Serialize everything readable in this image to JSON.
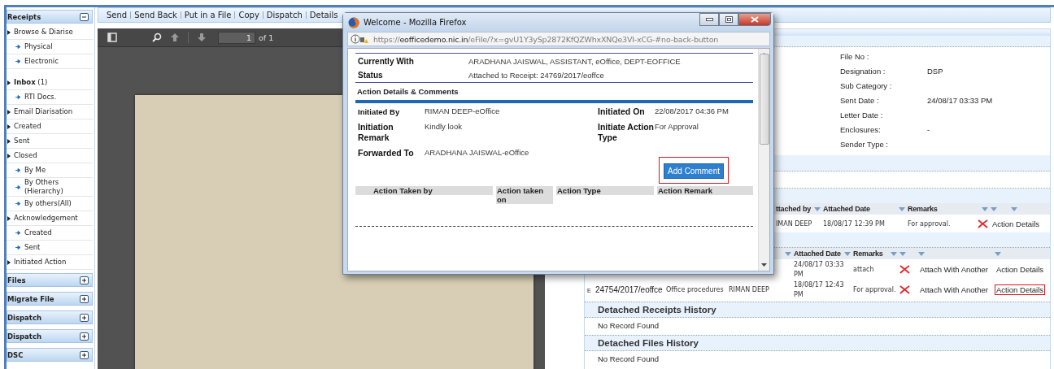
{
  "sidebar": {
    "sections": [
      {
        "title": "Receipts",
        "expanded": true,
        "items": [
          {
            "label": "Browse & Diarise",
            "children": [
              {
                "label": "Physical"
              },
              {
                "label": "Electronic"
              }
            ]
          },
          {
            "label": "**Inbox** (1)",
            "children": [
              {
                "label": "RTI Docs."
              }
            ]
          },
          {
            "label": "Email Diarisation"
          },
          {
            "label": "Created"
          },
          {
            "label": "Sent"
          },
          {
            "label": "Closed",
            "children": [
              {
                "label": "By Me"
              },
              {
                "label": "By Others (Hierarchy)"
              },
              {
                "label": "By others(All)"
              }
            ]
          },
          {
            "label": "Acknowledgement",
            "children": [
              {
                "label": "Created"
              },
              {
                "label": "Sent"
              }
            ]
          },
          {
            "label": "Initiated Action"
          }
        ]
      },
      {
        "title": "Files",
        "expanded": false
      },
      {
        "title": "Migrate File",
        "expanded": false
      },
      {
        "title": "Dispatch",
        "expanded": false
      },
      {
        "title": "Dispatch",
        "expanded": false
      },
      {
        "title": "DSC",
        "expanded": false
      }
    ]
  },
  "toolbar": [
    "Send",
    "Send Back",
    "Put in a File",
    "Copy",
    "Dispatch",
    "Details"
  ],
  "pdf_viewer": {
    "page": "1",
    "page_count": "of 1"
  },
  "receipt_details": [
    {
      "label": "File No :"
    },
    {
      "label": "Designation :",
      "value": "DSP"
    },
    {
      "label": "Sub Category :"
    },
    {
      "label": "Sent Date :",
      "value": "24/08/17 03:33 PM"
    },
    {
      "label": "Letter Date :"
    },
    {
      "label": "Enclosures:",
      "value": "-"
    },
    {
      "label": "Sender Type :"
    }
  ],
  "attached_table": {
    "columns": [
      {
        "label": "ttached by"
      },
      {
        "label": "Attached Date"
      },
      {
        "label": "Remarks"
      },
      {},
      {}
    ],
    "rows": [
      {
        "sent_by": "IMAN DEEP",
        "date": "18/08/17 12:39 PM",
        "remarks": "For approval.",
        "detach": true,
        "details_action": "Action Details",
        "highlighted": false
      }
    ]
  },
  "attached_receipts_table": {
    "columns": [
      {},
      {},
      {},
      {},
      {
        "label": "Attached Date"
      },
      {
        "label": "Remarks"
      },
      {},
      {},
      {}
    ],
    "rows": [
      {
        "date": "24/08/17 03:33 PM",
        "remarks": "attach",
        "detach": true,
        "attach_action": "Attach With Another",
        "details_action": "Action Details",
        "highlighted": false
      },
      {
        "marker": "E",
        "file_no": "24754/2017/eoffce",
        "subject": "Office procedures",
        "sent_by": "RIMAN DEEP",
        "date": "18/08/17 12:43 PM",
        "remarks": "For approval.",
        "detach": true,
        "attach_action": "Attach With Another",
        "details_action": "Action Details",
        "highlighted": true
      }
    ]
  },
  "history": [
    {
      "title": "Detached Receipts History",
      "message": "No Record Found"
    },
    {
      "title": "Detached Files History",
      "message": "No Record Found"
    }
  ],
  "popup": {
    "title": "Welcome - Mozilla Firefox",
    "url": {
      "scheme": "https://",
      "host": "eofficedemo.nic.in",
      "path": "/eFile/?x=gvU1Y3ySp2872KfQZWhxXNQe3VI-xCG-#no-back-button"
    },
    "summary": [
      {
        "label": "Currently With",
        "value": "ARADHANA JAISWAL, ASSISTANT, eOffice, DEPT-EOFFICE"
      },
      {
        "label": "Status",
        "value": "Attached to Receipt: 24769/2017/eoffce"
      }
    ],
    "section_title": "Action Details & Comments",
    "details": [
      {
        "label": "Initiated By",
        "value": "RIMAN DEEP-eOffice"
      },
      {
        "label": "Initiated On",
        "value": "22/08/2017 04:36 PM"
      },
      {
        "label": "Initiation Remark",
        "value": "Kindly look"
      },
      {
        "label": "Initiate Action Type",
        "value": "For Approval"
      },
      {
        "label": "Forwarded To",
        "value": "ARADHANA JAISWAL-eOffice"
      }
    ],
    "button": {
      "label": "Add Comment",
      "highlighted": true
    },
    "table_columns": [
      "Action Taken by",
      "Action taken on",
      "Action Type",
      "Action Remark"
    ]
  }
}
